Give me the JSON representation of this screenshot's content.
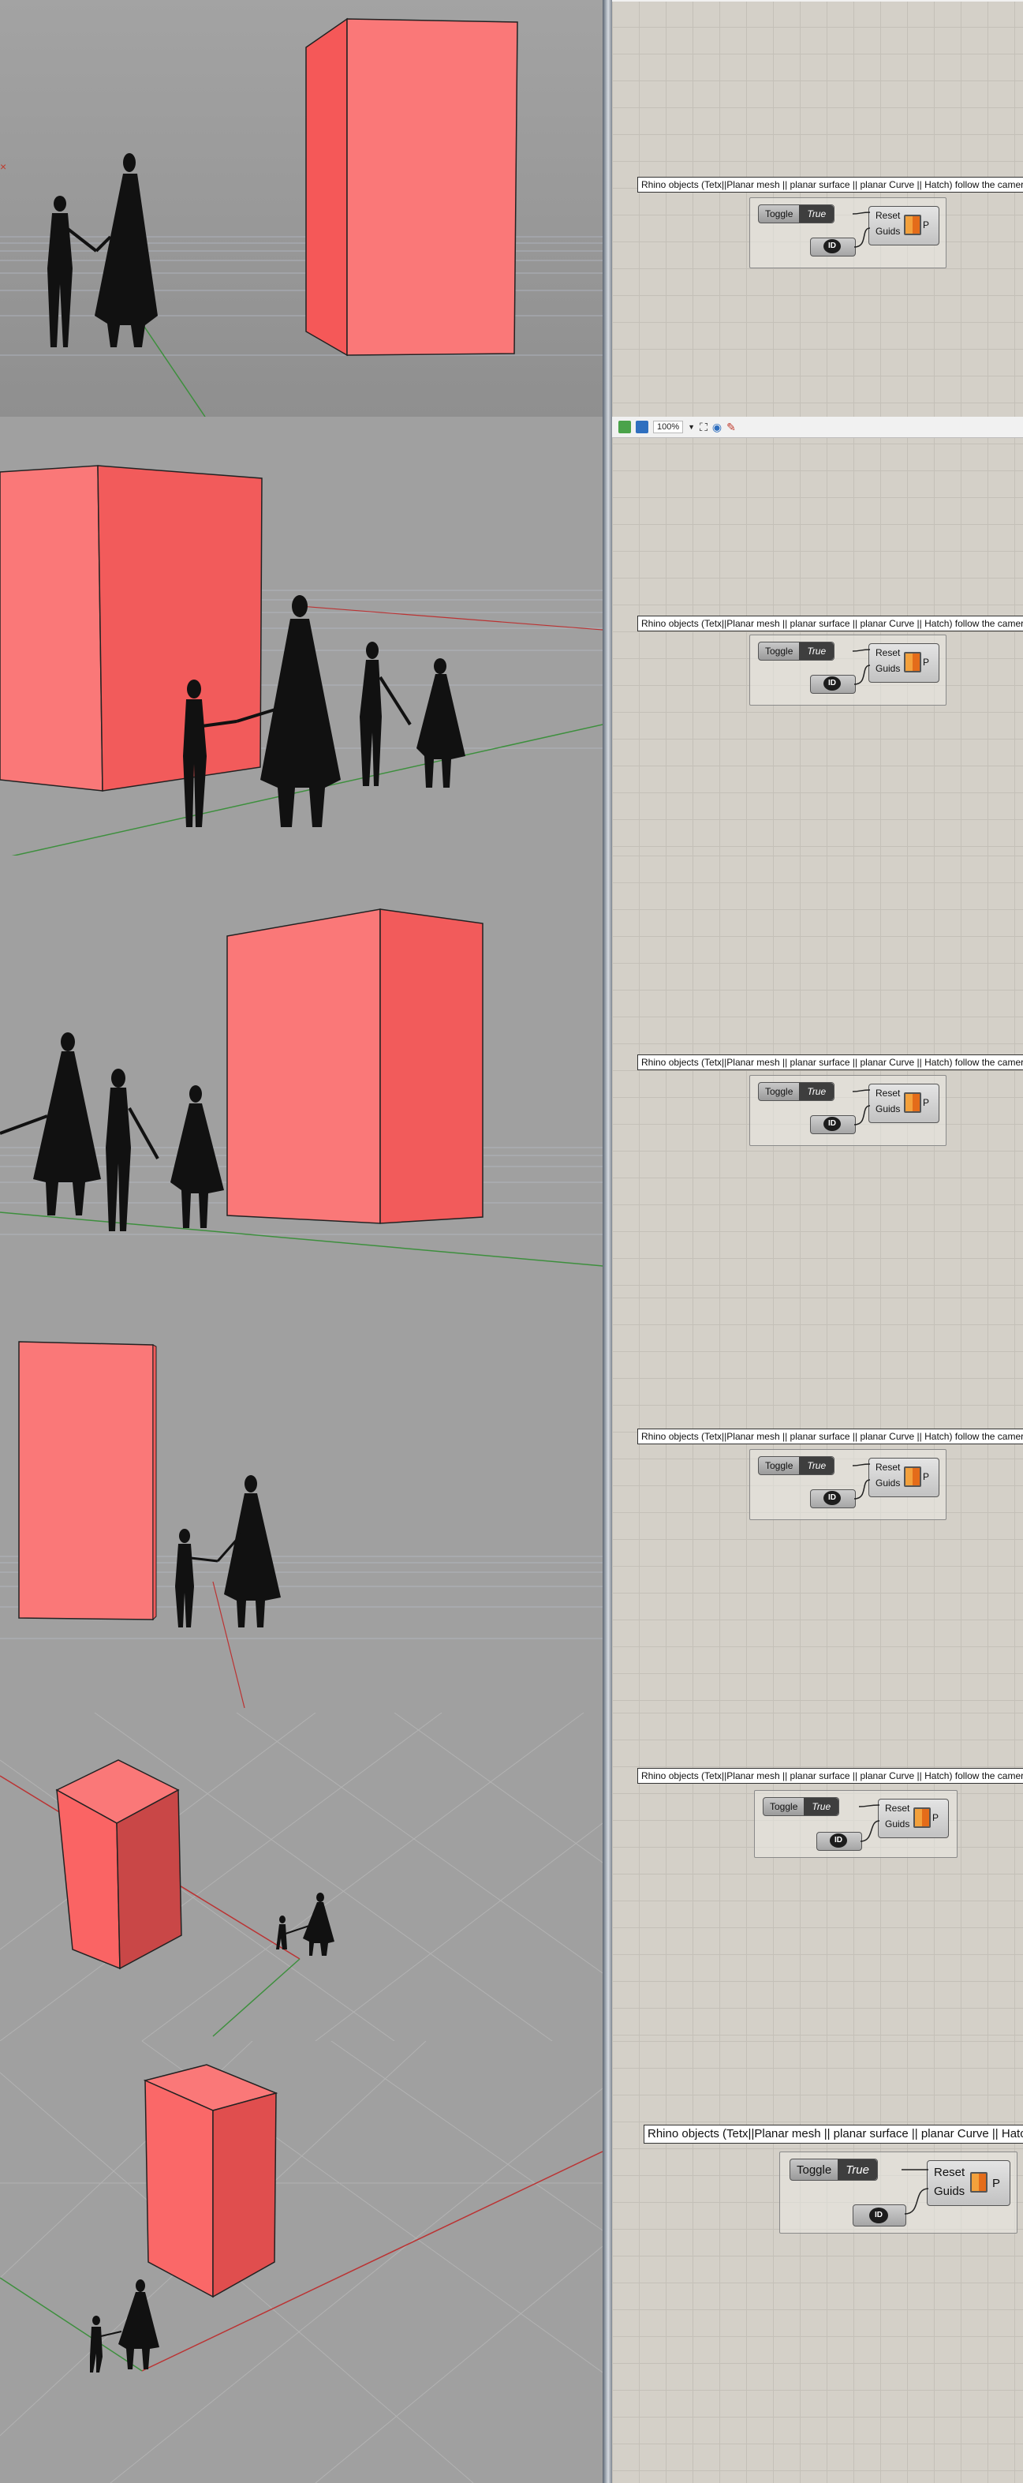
{
  "panels": [
    {
      "id": "p1",
      "toolbar": null
    },
    {
      "id": "p2",
      "toolbar": {
        "zoom": "100%"
      }
    },
    {
      "id": "p3",
      "toolbar": null
    },
    {
      "id": "p4",
      "toolbar": null
    },
    {
      "id": "p5",
      "toolbar": null
    },
    {
      "id": "p6",
      "toolbar": null
    }
  ],
  "grasshopper": {
    "group_label": "Rhino objects  (Tetx||Planar mesh || planar surface || planar Curve || Hatch) follow the camera",
    "group_label_last": "Rhino objects  (Tetx||Planar mesh || planar surface || planar Curve || Hatch).",
    "toggle_label": "Toggle",
    "toggle_value": "True",
    "reset_label": "Reset",
    "guids_label": "Guids",
    "output_label": "P",
    "id_label": "ID"
  },
  "colors": {
    "box_front": "#fa7474",
    "box_side": "#f25b5b",
    "box_dark": "#c94747",
    "viewport_bg": "#9e9e9e",
    "canvas_bg": "#d4d0c8"
  },
  "icons": [
    "padlock-icon",
    "save-icon",
    "zoom-dropdown-icon",
    "zoom-extents-icon",
    "eye-icon",
    "sketch-icon",
    "x-axis-marker-icon"
  ]
}
